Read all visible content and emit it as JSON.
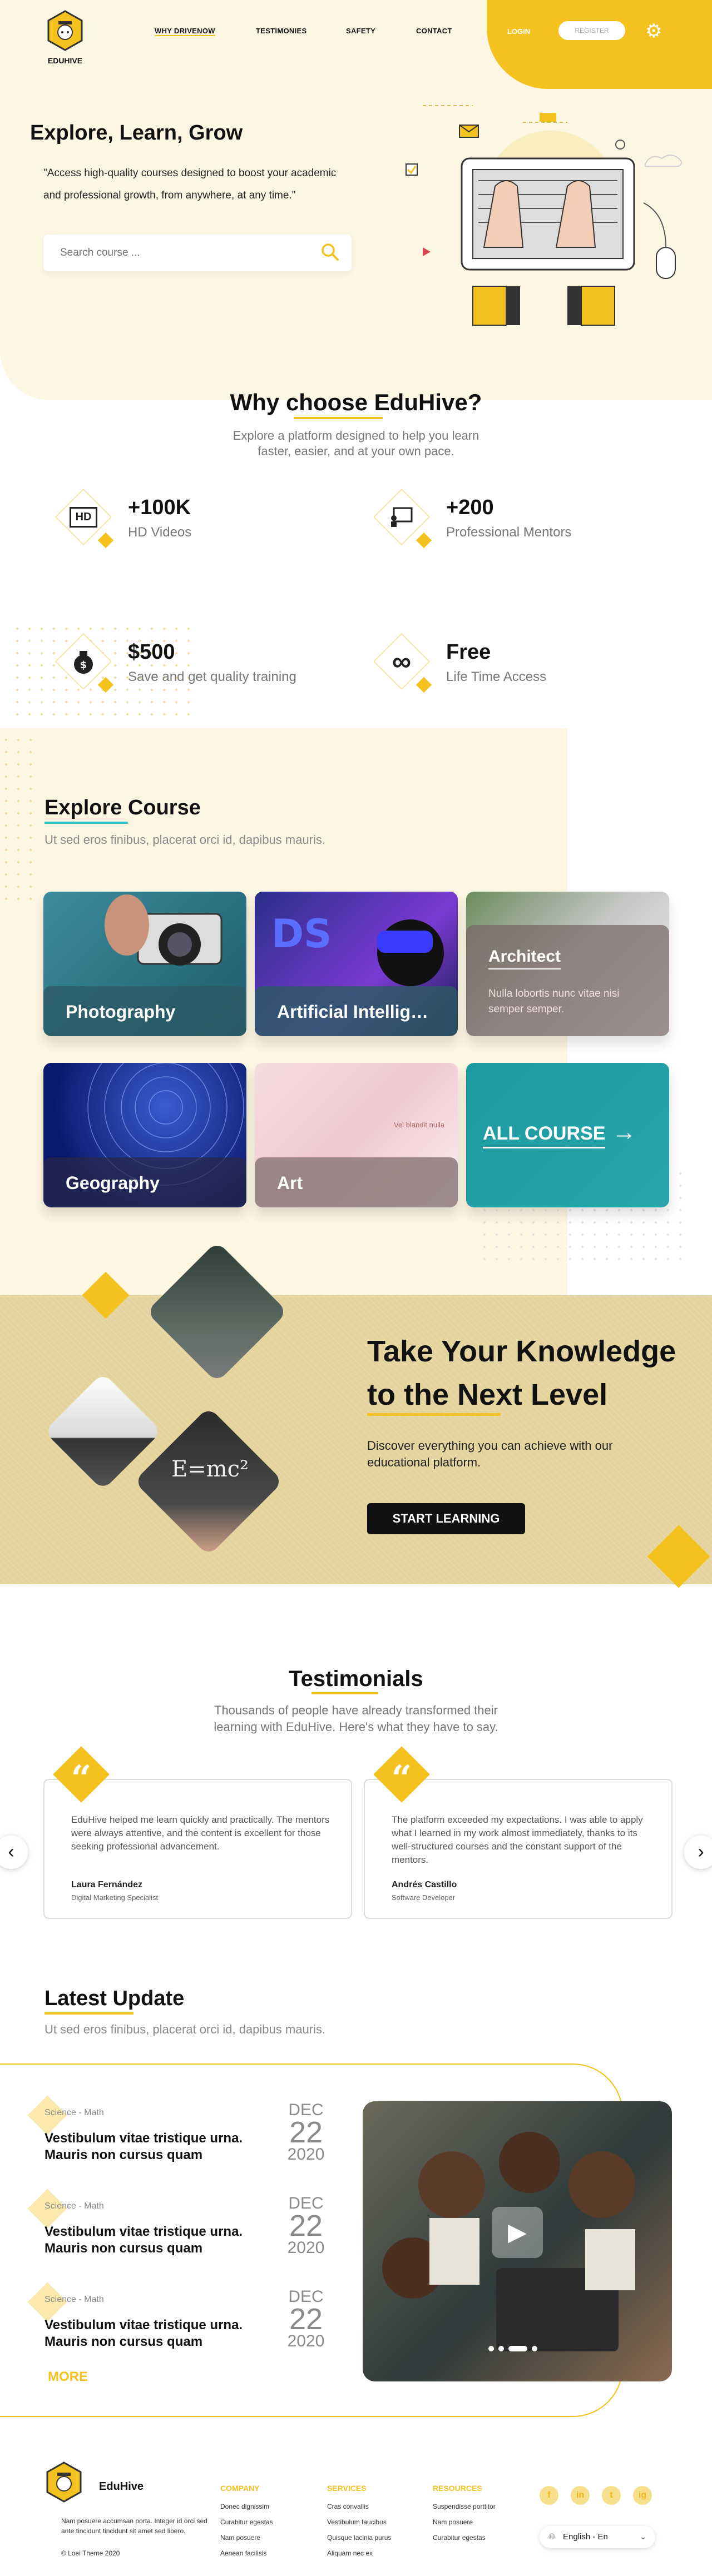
{
  "brand": {
    "name": "EDUHIVE",
    "accent": "#f4c21f"
  },
  "nav": {
    "items": [
      "WHY DRIVENOW",
      "TESTIMONIES",
      "SAFETY",
      "CONTACT"
    ]
  },
  "auth": {
    "login": "LOGIN",
    "register": "REGISTER"
  },
  "hero": {
    "title": "Explore, Learn, Grow",
    "quote": "\"Access high-quality courses designed to boost your academic and professional growth, from anywhere, at any time.\"",
    "search_placeholder": "Search course ..."
  },
  "why": {
    "title": "Why choose EduHive?",
    "subtitle": "Explore a platform designed to help you learn faster, easier, and at your own pace.",
    "features": [
      {
        "value": "+100K",
        "label": "HD Videos",
        "icon": "hd-video-icon"
      },
      {
        "value": "+200",
        "label": "Professional Mentors",
        "icon": "mentor-board-icon"
      },
      {
        "value": "$500",
        "label": "Save and get quality training",
        "icon": "money-bag-icon"
      },
      {
        "value": "Free",
        "label": "Life Time Access",
        "icon": "infinity-icon"
      }
    ]
  },
  "explore": {
    "title": "Explore Course",
    "subtitle": "Ut sed eros finibus, placerat orci id, dapibus mauris.",
    "courses": [
      "Photography",
      "Artificial Intelligence",
      "Architect",
      "Geography",
      "Art"
    ],
    "architect_desc": "Nulla lobortis nunc vitae nisi semper semper.",
    "art_note": "Vel blandit nulla",
    "all_course": "ALL COURSE"
  },
  "knowledge": {
    "title_line1": "Take Your Knowledge",
    "title_line2": "to the Next Level",
    "subtitle": "Discover everything you can achieve with our educational platform.",
    "cta": "START LEARNING"
  },
  "testimonials": {
    "title": "Testimonials",
    "subtitle": "Thousands of people have already transformed their learning with EduHive. Here's what they have to say.",
    "items": [
      {
        "text": "EduHive helped me learn quickly and practically. The mentors were always attentive, and the content is excellent for those seeking professional advancement.",
        "name": "Laura Fernández",
        "role": "Digital Marketing Specialist"
      },
      {
        "text": "The platform exceeded my expectations. I was able to apply what I learned in my work almost immediately, thanks to its well-structured courses and the constant support of the mentors.",
        "name": "Andrés Castillo",
        "role": "Software Developer"
      }
    ]
  },
  "latest": {
    "title": "Latest Update",
    "subtitle": "Ut sed eros finibus, placerat orci id, dapibus mauris.",
    "posts": [
      {
        "tag": "Science - Math",
        "title": "Vestibulum vitae tristique urna. Mauris non cursus quam",
        "month": "DEC",
        "day": "22",
        "year": "2020"
      },
      {
        "tag": "Science - Math",
        "title": "Vestibulum vitae tristique urna. Mauris non cursus quam",
        "month": "DEC",
        "day": "22",
        "year": "2020"
      },
      {
        "tag": "Science - Math",
        "title": "Vestibulum vitae tristique urna. Mauris non cursus quam",
        "month": "DEC",
        "day": "22",
        "year": "2020"
      }
    ],
    "more": "MORE"
  },
  "footer": {
    "brand": "EduHive",
    "about": "Nam posuere accumsan porta. Integer id orci sed ante tincidunt tincidunt sit amet sed libero.",
    "copyright": "© Loei Theme 2020",
    "columns": [
      {
        "title": "COMPANY",
        "links": [
          "Donec dignissim",
          "Curabitur egestas",
          "Nam posuere",
          "Aenean facilisis"
        ]
      },
      {
        "title": "SERVICES",
        "links": [
          "Cras convallis",
          "Vestibulum faucibus",
          "Quisque lacinia purus",
          "Aliquam nec ex"
        ]
      },
      {
        "title": "RESOURCES",
        "links": [
          "Suspendisse porttitor",
          "Nam posuere",
          "Curabitur egestas"
        ]
      }
    ],
    "social": [
      "f",
      "in",
      "t",
      "ig"
    ],
    "language": "English - En"
  }
}
